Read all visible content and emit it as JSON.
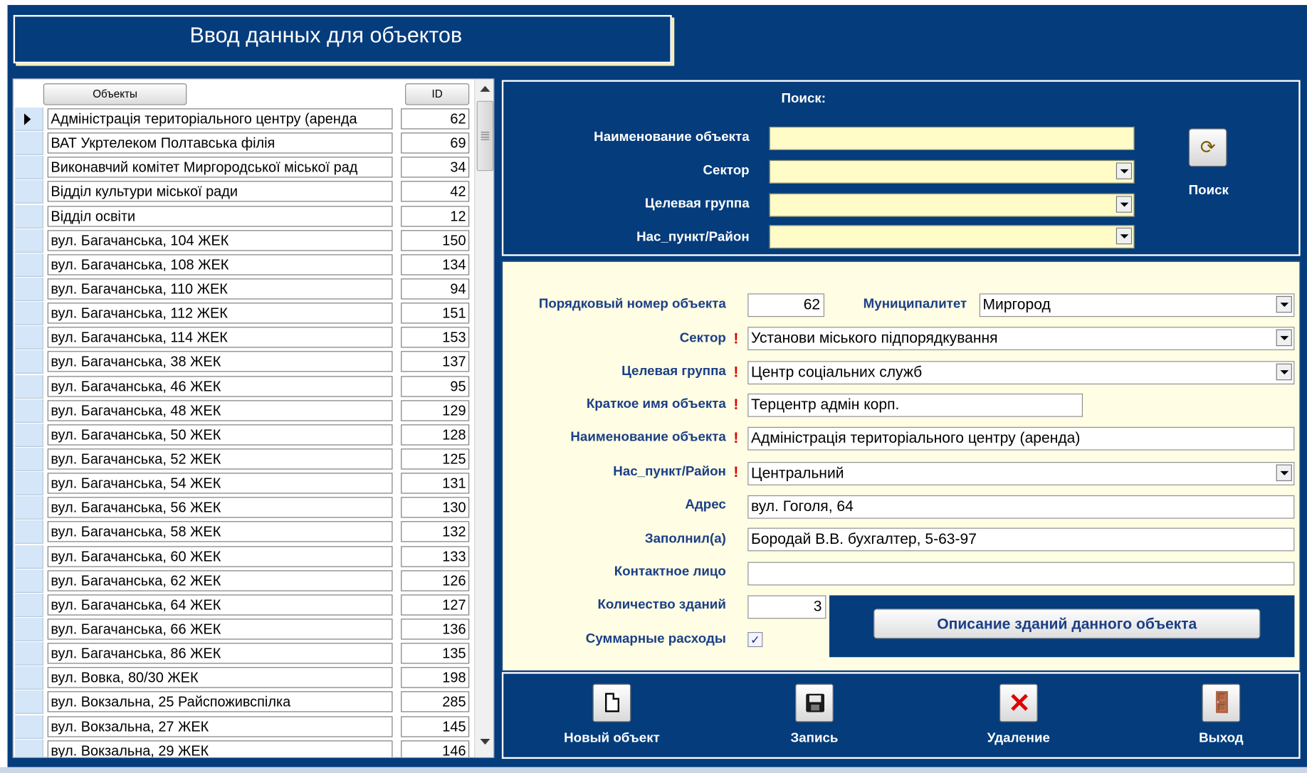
{
  "window": {
    "title": "Ввод данных для объектов"
  },
  "list": {
    "headers": {
      "objects": "Объекты",
      "id": "ID"
    },
    "rows": [
      {
        "name": "Адміністрація територіального центру (аренда",
        "id": "62"
      },
      {
        "name": "ВАТ Укртелеком Полтавська філія",
        "id": "69"
      },
      {
        "name": "Виконавчий комітет Миргородської міської рад",
        "id": "34"
      },
      {
        "name": "Відділ культури міської ради",
        "id": "42"
      },
      {
        "name": "Відділ освіти",
        "id": "12"
      },
      {
        "name": "вул. Багачанська, 104 ЖЕК",
        "id": "150"
      },
      {
        "name": "вул. Багачанська, 108 ЖЕК",
        "id": "134"
      },
      {
        "name": "вул. Багачанська, 110 ЖЕК",
        "id": "94"
      },
      {
        "name": "вул. Багачанська, 112 ЖЕК",
        "id": "151"
      },
      {
        "name": "вул. Багачанська, 114 ЖЕК",
        "id": "153"
      },
      {
        "name": "вул. Багачанська, 38 ЖЕК",
        "id": "137"
      },
      {
        "name": "вул. Багачанська, 46 ЖЕК",
        "id": "95"
      },
      {
        "name": "вул. Багачанська, 48 ЖЕК",
        "id": "129"
      },
      {
        "name": "вул. Багачанська, 50 ЖЕК",
        "id": "128"
      },
      {
        "name": "вул. Багачанська, 52 ЖЕК",
        "id": "125"
      },
      {
        "name": "вул. Багачанська, 54 ЖЕК",
        "id": "131"
      },
      {
        "name": "вул. Багачанська, 56 ЖЕК",
        "id": "130"
      },
      {
        "name": "вул. Багачанська, 58 ЖЕК",
        "id": "132"
      },
      {
        "name": "вул. Багачанська, 60 ЖЕК",
        "id": "133"
      },
      {
        "name": "вул. Багачанська, 62 ЖЕК",
        "id": "126"
      },
      {
        "name": "вул. Багачанська, 64 ЖЕК",
        "id": "127"
      },
      {
        "name": "вул. Багачанська, 66 ЖЕК",
        "id": "136"
      },
      {
        "name": "вул. Багачанська, 86 ЖЕК",
        "id": "135"
      },
      {
        "name": "вул. Вовка, 80/30 ЖЕК",
        "id": "198"
      },
      {
        "name": "вул. Вокзальна, 25 Райспоживспілка",
        "id": "285"
      },
      {
        "name": "вул. Вокзальна, 27 ЖЕК",
        "id": "145"
      },
      {
        "name": "вул. Вокзальна, 29 ЖЕК",
        "id": "146"
      }
    ]
  },
  "search": {
    "title": "Поиск:",
    "fields": {
      "name_label": "Наименование объекта",
      "sector_label": "Сектор",
      "group_label": "Целевая группа",
      "district_label": "Нас_пункт/Район"
    },
    "button_label": "Поиск",
    "icon": "search-refresh-icon"
  },
  "details": {
    "seq_label": "Порядковый номер объекта",
    "seq_value": "62",
    "muni_label": "Муниципалитет",
    "muni_value": "Миргород",
    "sector_label": "Сектор",
    "sector_value": "Установи міського підпорядкування",
    "group_label": "Целевая группа",
    "group_value": "Центр соціальних служб",
    "short_label": "Краткое имя объекта",
    "short_value": "Терцентр адмін корп.",
    "name_label": "Наименование объекта",
    "name_value": "Адміністрація територіального центру (аренда)",
    "district_label": "Нас_пункт/Район",
    "district_value": "Центральний",
    "address_label": "Адрес",
    "address_value": "вул. Гоголя, 64",
    "filled_label": "Заполнил(а)",
    "filled_value": "Бородай В.В. бухгалтер, 5-63-97",
    "contact_label": "Контактное лицо",
    "contact_value": "",
    "buildings_label": "Количество зданий",
    "buildings_value": "3",
    "buildings_button": "Описание зданий данного объекта",
    "summary_label": "Суммарные расходы",
    "summary_checked": true,
    "required_mark": "!"
  },
  "actions": {
    "new_label": "Новый объект",
    "save_label": "Запись",
    "delete_label": "Удаление",
    "exit_label": "Выход"
  },
  "colors": {
    "form_bg": "#043c7c",
    "input_yellow": "#fffcc8",
    "panel_cream": "#fffde3",
    "label_blue": "#1b3f87",
    "required_red": "#e00000"
  }
}
